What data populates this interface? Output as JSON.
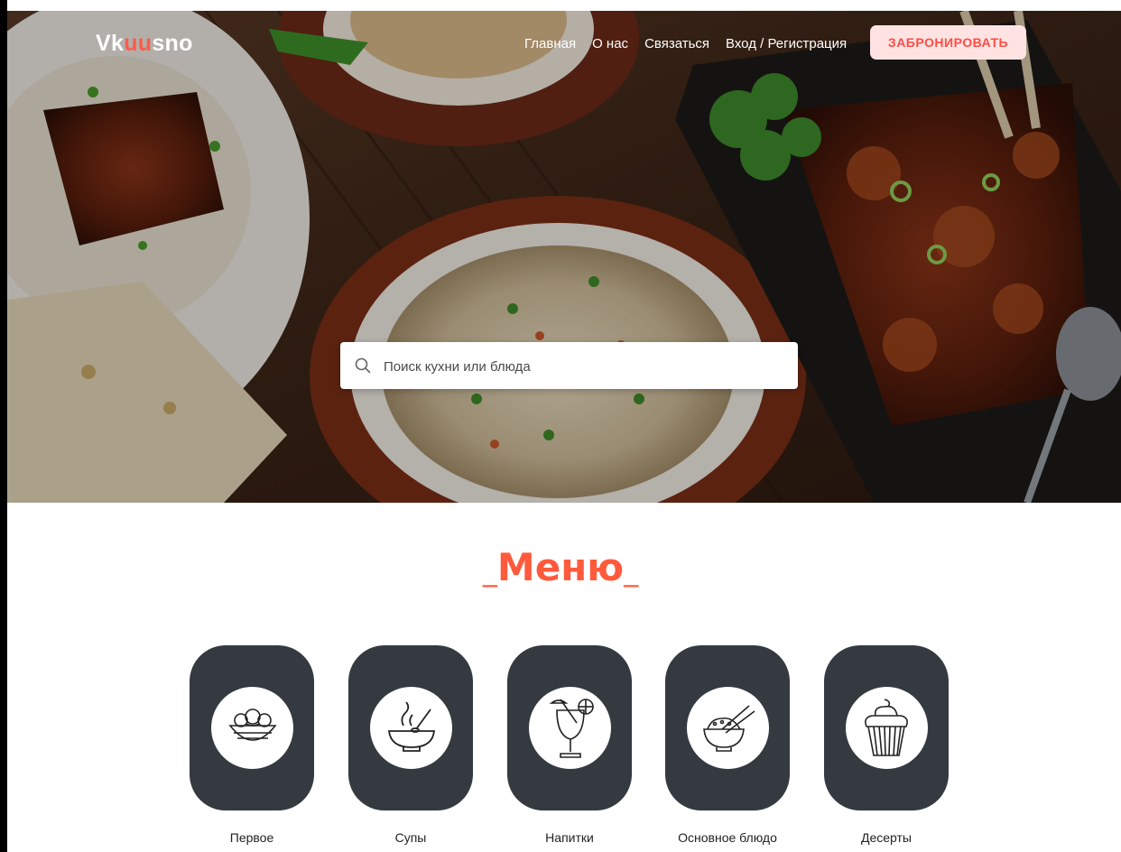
{
  "brand": {
    "logo_prefix": "Vk",
    "logo_accent": "uu",
    "logo_suffix": "sno",
    "accent_color": "#ff5a4a"
  },
  "nav": {
    "links": [
      {
        "label": "Главная"
      },
      {
        "label": "О нас"
      },
      {
        "label": "Связаться"
      },
      {
        "label": "Вход / Регистрация"
      }
    ],
    "book_button": "ЗАБРОНИРОВАТЬ"
  },
  "hero": {
    "image_alt": "food-background"
  },
  "search": {
    "placeholder": "Поиск кухни или блюда",
    "value": "",
    "icon": "search-icon"
  },
  "menu": {
    "title": "Меню",
    "title_prefix": "_",
    "title_suffix": "_",
    "categories": [
      {
        "label": "Первое",
        "icon": "salad-icon"
      },
      {
        "label": "Супы",
        "icon": "soup-bowl-icon"
      },
      {
        "label": "Напитки",
        "icon": "cocktail-icon"
      },
      {
        "label": "Основное блюдо",
        "icon": "rice-bowl-icon"
      },
      {
        "label": "Десерты",
        "icon": "cupcake-icon"
      }
    ]
  }
}
